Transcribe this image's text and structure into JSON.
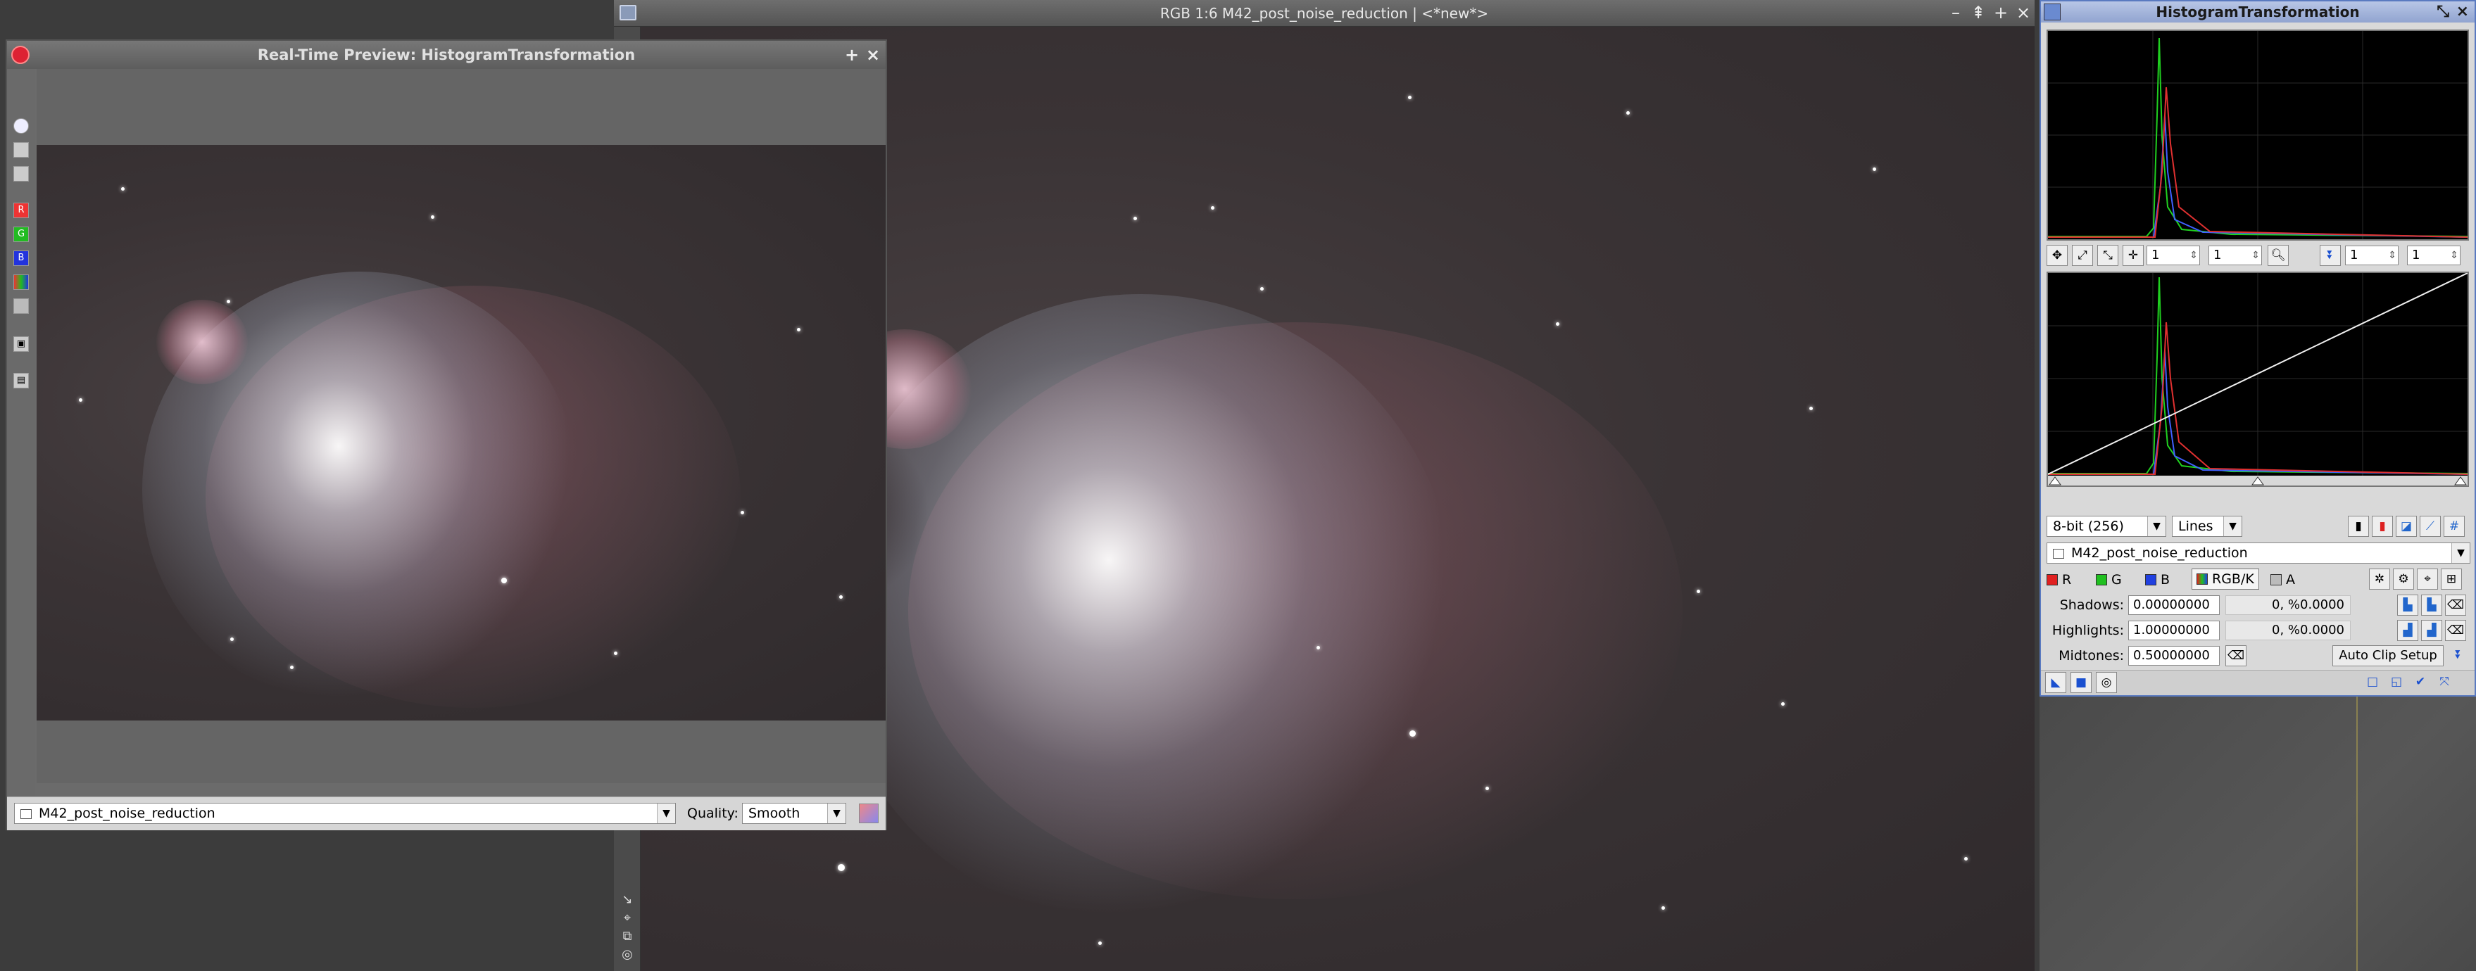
{
  "main_window": {
    "title": "RGB 1:6 M42_post_noise_reduction | <*new*>",
    "controls": [
      "–",
      "⇞",
      "+",
      "×"
    ]
  },
  "preview_window": {
    "title": "Real-Time Preview: HistogramTransformation",
    "add_symbol": "+",
    "close_symbol": "×",
    "view_select": "M42_post_noise_reduction",
    "quality_label": "Quality:",
    "quality_value": "Smooth",
    "tool_letters": {
      "r": "R",
      "g": "G",
      "b": "B"
    }
  },
  "histogram_panel": {
    "title": "HistogramTransformation",
    "zoom_h": "1",
    "zoom_v": "1",
    "zoom_h2": "1",
    "zoom_v2": "1",
    "resolution": "8-bit (256)",
    "graph_style": "Lines",
    "target_view": "M42_post_noise_reduction",
    "channels": {
      "r": "R",
      "g": "G",
      "b": "B",
      "rgbk": "RGB/K",
      "a": "A"
    },
    "shadows_label": "Shadows:",
    "shadows_value": "0.00000000",
    "shadows_clip": "0, %0.0000",
    "highlights_label": "Highlights:",
    "highlights_value": "1.00000000",
    "highlights_clip": "0, %0.0000",
    "midtones_label": "Midtones:",
    "midtones_value": "0.50000000",
    "auto_clip_label": "Auto Clip Setup"
  },
  "colors": {
    "red_channel": "#e02020",
    "green_channel": "#20c020",
    "blue_channel": "#2040e0",
    "panel_title_bg": "#a8b8e0"
  }
}
